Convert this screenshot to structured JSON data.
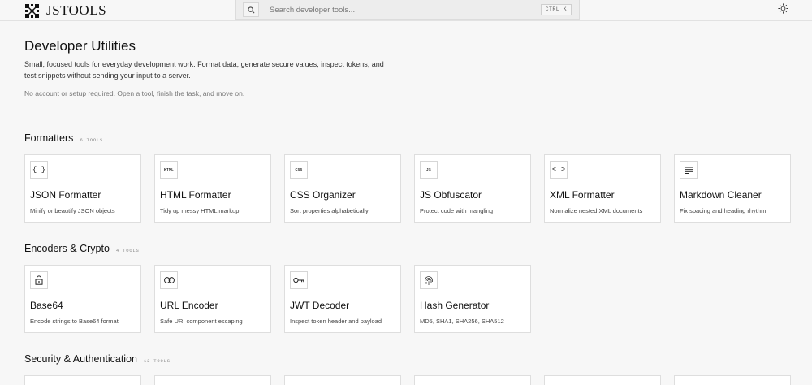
{
  "header": {
    "brand_name": "JSTOOLS",
    "search_placeholder": "Search developer tools...",
    "shortcut": "CTRL K",
    "theme_icon": "sun-icon"
  },
  "intro": {
    "title": "Developer Utilities",
    "description": "Small, focused tools for everyday development work. Format data, generate secure values, inspect tokens, and test snippets without sending your input to a server.",
    "note": "No account or setup required. Open a tool, finish the task, and move on."
  },
  "sections": [
    {
      "title": "Formatters",
      "count": "6 TOOLS",
      "tools": [
        {
          "icon": "braces-icon",
          "icon_text": "{ }",
          "title": "JSON Formatter",
          "desc": "Minify or beautify JSON objects"
        },
        {
          "icon": "html-tag-icon",
          "icon_text": "HTML",
          "title": "HTML Formatter",
          "desc": "Tidy up messy HTML markup"
        },
        {
          "icon": "css-tag-icon",
          "icon_text": "CSS",
          "title": "CSS Organizer",
          "desc": "Sort properties alphabetically"
        },
        {
          "icon": "js-tag-icon",
          "icon_text": "JS",
          "title": "JS Obfuscator",
          "desc": "Protect code with mangling"
        },
        {
          "icon": "angle-brackets-icon",
          "icon_text": "< >",
          "title": "XML Formatter",
          "desc": "Normalize nested XML documents"
        },
        {
          "icon": "lines-icon",
          "icon_text": "",
          "title": "Markdown Cleaner",
          "desc": "Fix spacing and heading rhythm"
        }
      ]
    },
    {
      "title": "Encoders & Crypto",
      "count": "4 TOOLS",
      "tools": [
        {
          "icon": "lock-icon",
          "icon_text": "",
          "title": "Base64",
          "desc": "Encode strings to Base64 format"
        },
        {
          "icon": "link-icon",
          "icon_text": "",
          "title": "URL Encoder",
          "desc": "Safe URI component escaping"
        },
        {
          "icon": "key-icon",
          "icon_text": "",
          "title": "JWT Decoder",
          "desc": "Inspect token header and payload"
        },
        {
          "icon": "fingerprint-icon",
          "icon_text": "",
          "title": "Hash Generator",
          "desc": "MD5, SHA1, SHA256, SHA512"
        }
      ]
    },
    {
      "title": "Security & Authentication",
      "count": "12 TOOLS"
    }
  ]
}
